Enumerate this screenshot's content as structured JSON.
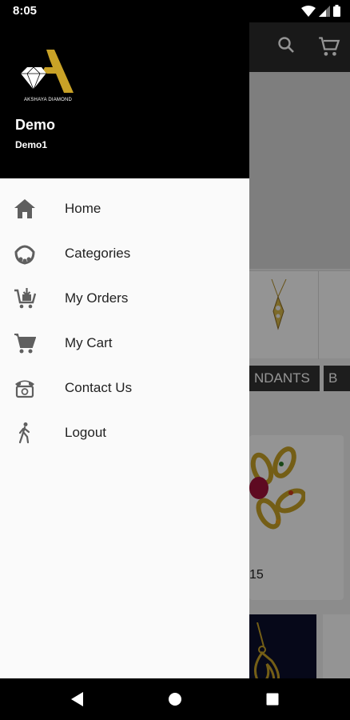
{
  "status_bar": {
    "time": "8:05"
  },
  "drawer": {
    "brand_text": "AKSHAYA DIAMOND",
    "user_name": "Demo",
    "user_subtitle": "Demo1",
    "items": [
      {
        "label": "Home",
        "icon": "home-icon"
      },
      {
        "label": "Categories",
        "icon": "necklace-icon"
      },
      {
        "label": "My Orders",
        "icon": "cart-download-icon"
      },
      {
        "label": "My Cart",
        "icon": "cart-icon"
      },
      {
        "label": "Contact Us",
        "icon": "telephone-icon"
      },
      {
        "label": "Logout",
        "icon": "walking-person-icon"
      }
    ]
  },
  "background_app": {
    "category_label": "NDANTS",
    "category_label_2": "B",
    "product_price": "15"
  },
  "colors": {
    "drawer_header": "#000000",
    "drawer_body": "#fafafa",
    "gold": "#c9a227"
  }
}
